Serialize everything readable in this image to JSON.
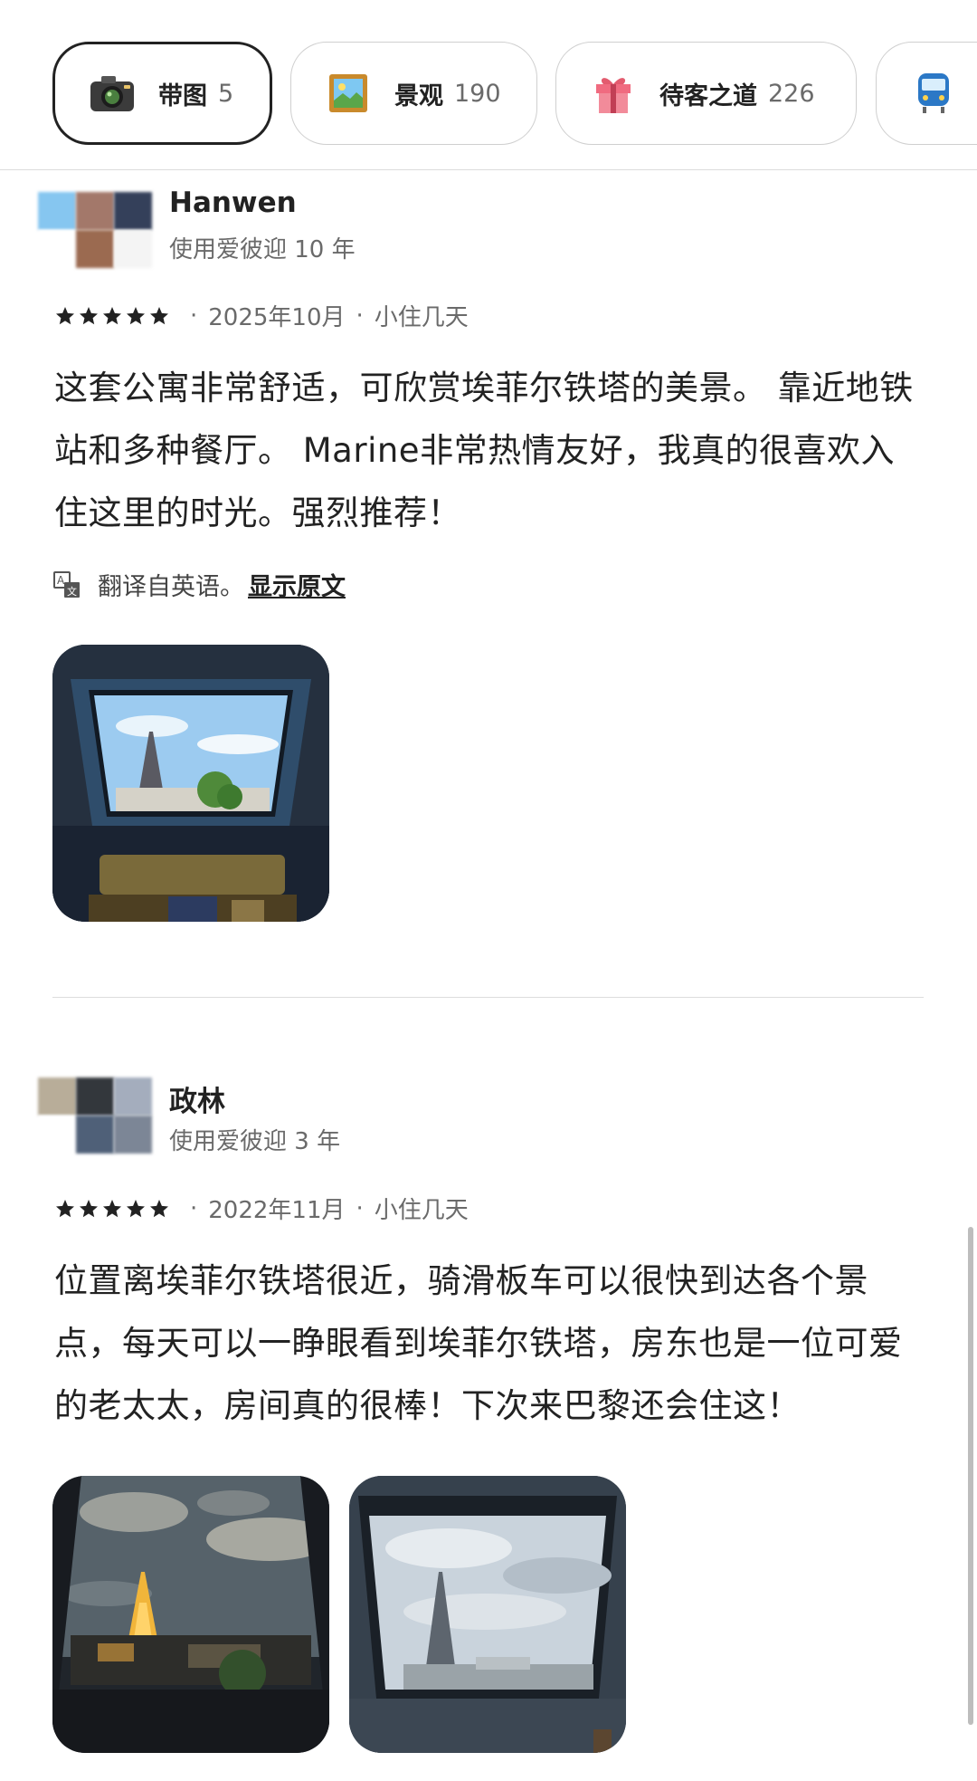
{
  "filters": [
    {
      "label": "带图",
      "count": "5",
      "icon": "camera-icon",
      "selected": true
    },
    {
      "label": "景观",
      "count": "190",
      "icon": "landscape-picture-icon",
      "selected": false
    },
    {
      "label": "待客之道",
      "count": "226",
      "icon": "gift-icon",
      "selected": false
    },
    {
      "label": "",
      "count": "",
      "icon": "train-icon",
      "selected": false
    }
  ],
  "reviews": [
    {
      "name": "Hanwen",
      "tenure": "使用爱彼迎 10 年",
      "rating": 5,
      "date": "2025年10月",
      "stay": "小住几天",
      "separator": "·",
      "body": "这套公寓非常舒适，可欣赏埃菲尔铁塔的美景。 靠近地铁站和多种餐厅。 Marine非常热情友好，我真的很喜欢入住这里的时光。强烈推荐！",
      "translation_note": "翻译自英语。",
      "show_original": "显示原文",
      "photos": [
        "skylight-window-eiffel-tower-photo"
      ]
    },
    {
      "name": "政林",
      "tenure": "使用爱彼迎 3 年",
      "rating": 5,
      "date": "2022年11月",
      "stay": "小住几天",
      "separator": "·",
      "body": "位置离埃菲尔铁塔很近，骑滑板车可以很快到达各个景点，每天可以一睁眼看到埃菲尔铁塔，房东也是一位可爱的老太太，房间真的很棒！下次来巴黎还会住这！",
      "photos": [
        "night-eiffel-tower-window-photo",
        "day-eiffel-tower-window-photo"
      ]
    }
  ],
  "colors": {
    "text": "#222222",
    "muted": "#6a6a6a",
    "border": "#dddddd"
  }
}
